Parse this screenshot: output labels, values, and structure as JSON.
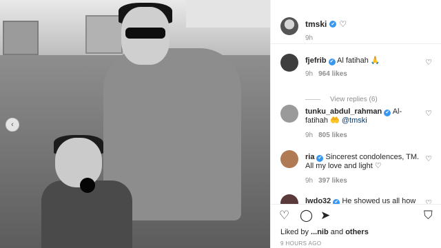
{
  "post": {
    "owner": "tmski",
    "time": "9h",
    "liked_by_prefix": "Liked by",
    "liked_by_user": "...nib",
    "liked_by_and": "and",
    "liked_by_others": "others",
    "time_ago": "9 HOURS AGO"
  },
  "comments": [
    {
      "user": "fjefrib",
      "text": "Al fatihah 🙏",
      "time": "9h",
      "likes": "964 likes",
      "replies": "View replies (6)"
    },
    {
      "user": "tunku_abdul_rahman",
      "text": "Al-fatihah 🤲",
      "mention": "@tmski",
      "time": "9h",
      "likes": "805 likes"
    },
    {
      "user": "ria",
      "text": "Sincerest condolences, TM. All my love and light ♡",
      "time": "9h",
      "likes": "397 likes"
    },
    {
      "user": "lwdo32",
      "text": "He showed us all how"
    }
  ],
  "icons": {
    "verified": "✔",
    "heart": "♡",
    "comment": "◯",
    "share": "➤",
    "bookmark": "⛉",
    "carousel_prev": "‹"
  },
  "colors": {
    "verified": "#3897f0",
    "mention": "#00376b"
  }
}
